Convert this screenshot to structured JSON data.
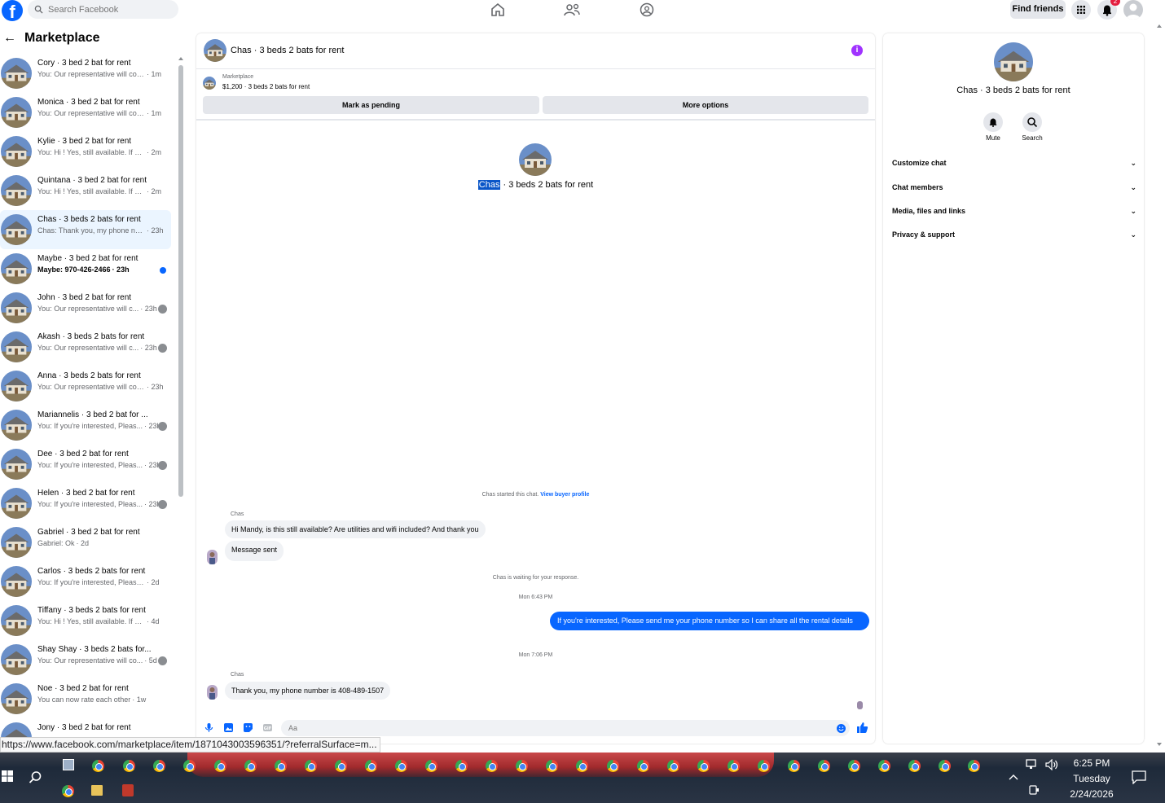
{
  "topbar": {
    "search_placeholder": "Search Facebook",
    "find_friends": "Find friends",
    "notification_count": "2",
    "icons": [
      "facebook-logo",
      "home-icon",
      "friends-icon",
      "groups-icon",
      "apps-grid-icon",
      "bell-icon",
      "profile-icon"
    ]
  },
  "sidebar": {
    "title": "Marketplace",
    "conversations": [
      {
        "name": "Cory · 3 bed 2 bat for rent",
        "preview": "You: Our representative will cont...",
        "time": "· 1m",
        "unread": false,
        "active": false
      },
      {
        "name": "Monica · 3 bed 2 bat for rent",
        "preview": "You: Our representative will cont...",
        "time": "· 1m",
        "unread": false,
        "active": false
      },
      {
        "name": "Kylie · 3 bed 2 bat for rent",
        "preview": "You: Hi ! Yes, still available. If you'...",
        "time": "· 2m",
        "unread": false,
        "active": false
      },
      {
        "name": "Quintana · 3 bed 2 bat for rent",
        "preview": "You: Hi ! Yes, still available. If you'...",
        "time": "· 2m",
        "unread": false,
        "active": false
      },
      {
        "name": "Chas · 3 beds 2 bats for rent",
        "preview": "Chas: Thank you, my phone num...",
        "time": "· 23h",
        "unread": false,
        "active": true
      },
      {
        "name": "Maybe · 3 bed 2 bat for rent",
        "preview": "Maybe: 970-426-2466",
        "time": "· 23h",
        "unread": true,
        "active": false
      },
      {
        "name": "John · 3 bed 2 bat for rent",
        "preview": "You: Our representative will c...",
        "time": "· 23h",
        "unread": false,
        "active": false
      },
      {
        "name": "Akash · 3 beds 2 bats for rent",
        "preview": "You: Our representative will c...",
        "time": "· 23h",
        "unread": false,
        "active": false
      },
      {
        "name": "Anna · 3 beds 2 bats for rent",
        "preview": "You: Our representative will cont...",
        "time": "· 23h",
        "unread": false,
        "active": false
      },
      {
        "name": "Mariannelis · 3 bed 2 bat for ...",
        "preview": "You: If you're interested, Pleas...",
        "time": "· 23h",
        "unread": false,
        "active": false
      },
      {
        "name": "Dee · 3 bed 2 bat for rent",
        "preview": "You: If you're interested, Pleas...",
        "time": "· 23h",
        "unread": false,
        "active": false
      },
      {
        "name": "Helen · 3 bed 2 bat for rent",
        "preview": "You: If you're interested, Pleas...",
        "time": "· 23h",
        "unread": false,
        "active": false
      },
      {
        "name": "Gabriel · 3 bed 2 bat for rent",
        "preview": "Gabriel: Ok",
        "time": "· 2d",
        "unread": false,
        "active": false
      },
      {
        "name": "Carlos · 3 beds 2 bats for rent",
        "preview": "You: If you're interested, Please se...",
        "time": "· 2d",
        "unread": false,
        "active": false
      },
      {
        "name": "Tiffany · 3 beds 2 bats for rent",
        "preview": "You: Hi ! Yes, still available. If you'r...",
        "time": "· 4d",
        "unread": false,
        "active": false
      },
      {
        "name": "Shay Shay · 3 beds 2 bats for...",
        "preview": "You: Our representative will co...",
        "time": "· 5d",
        "unread": false,
        "active": false
      },
      {
        "name": "Noe · 3 bed 2 bat for rent",
        "preview": "You can now rate each other",
        "time": "· 1w",
        "unread": false,
        "active": false
      },
      {
        "name": "Jony · 3 bed 2 bat for rent",
        "preview": "",
        "time": "",
        "unread": false,
        "active": false
      }
    ]
  },
  "chat": {
    "title": "Chas · 3 beds 2 bats for rent",
    "marketplace_label": "Marketplace",
    "item": "$1,200 · 3 beds 2 bats for rent",
    "mark_pending": "Mark as pending",
    "more_options": "More options",
    "hero_name": "Chas",
    "hero_rest": " · 3 beds 2 bats for rent",
    "started": "Chas started this chat.",
    "view_buyer": "View buyer profile",
    "sender": "Chas",
    "msg1": "Hi Mandy, is this still available? Are utilities and wifi included? And thank you",
    "msg2": "Message sent",
    "waiting": "Chas is waiting for your response.",
    "time1": "Mon 6:43 PM",
    "msg_out": "If you're interested, Please send me your phone number so I can share all the rental details",
    "time2": "Mon 7:06 PM",
    "msg3": "Thank you, my phone number is 408-489-1507",
    "composer_placeholder": "Aa"
  },
  "right_panel": {
    "title": "Chas · 3 beds 2 bats for rent",
    "mute": "Mute",
    "search": "Search",
    "items": [
      "Customize chat",
      "Chat members",
      "Media, files and links",
      "Privacy & support"
    ]
  },
  "status_url": "https://www.facebook.com/marketplace/item/1871043003596351/?referralSurface=m...",
  "taskbar": {
    "time": "6:25 PM",
    "day": "Tuesday",
    "date": "2/24/2026"
  },
  "colors": {
    "accent": "#0866ff",
    "bubble_in": "#f0f2f5",
    "info": "#a033ff",
    "badge": "#e41e3f"
  }
}
